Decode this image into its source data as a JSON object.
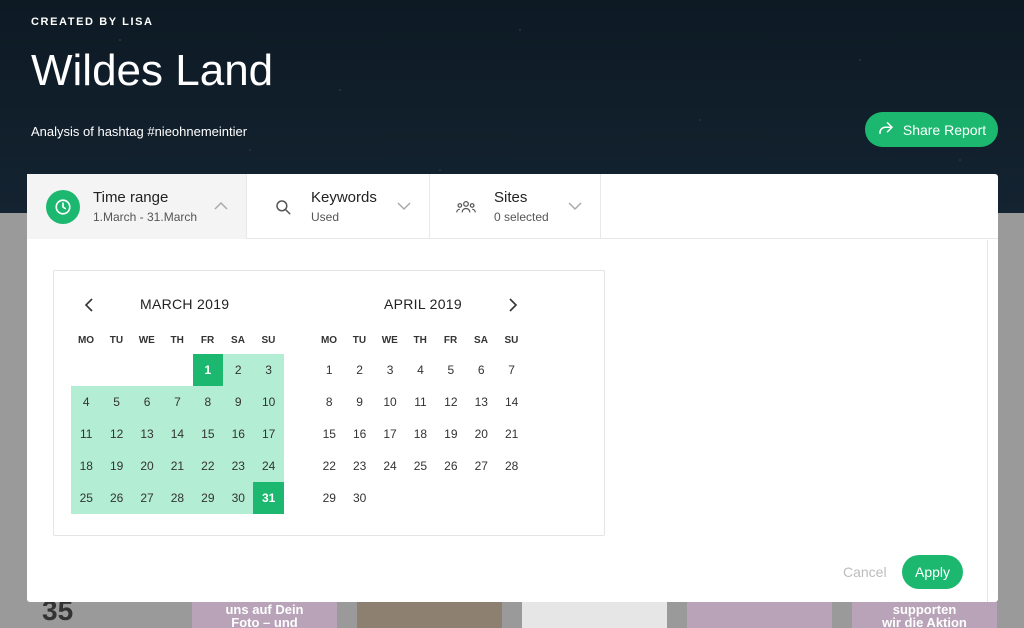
{
  "header": {
    "created_by": "CREATED BY LISA",
    "title": "Wildes Land",
    "subtitle": "Analysis of hashtag #nieohnemeintier",
    "share_label": "Share Report"
  },
  "filters": {
    "time": {
      "label": "Time range",
      "value": "1.March - 31.March"
    },
    "keywords": {
      "label": "Keywords",
      "value": "Used"
    },
    "sites": {
      "label": "Sites",
      "value": "0 selected"
    }
  },
  "calendar": {
    "left_month": "MARCH 2019",
    "right_month": "APRIL 2019",
    "weekdays": [
      "MO",
      "TU",
      "WE",
      "TH",
      "FR",
      "SA",
      "SU"
    ],
    "march_start_weekday": 4,
    "march_days": 31,
    "april_start_weekday": 0,
    "april_days": 30,
    "selected_start": 1,
    "selected_end": 31
  },
  "actions": {
    "cancel_label": "Cancel",
    "apply_label": "Apply"
  },
  "background": {
    "big_number": "35",
    "thumb1_text_a": "uns auf Dein",
    "thumb1_text_b": "Foto – und",
    "thumb6_text_a": "supporten",
    "thumb6_text_b": "wir die Aktion"
  },
  "colors": {
    "accent": "#1db870",
    "range": "#b3edd3",
    "header_bg": "#0f1923"
  }
}
